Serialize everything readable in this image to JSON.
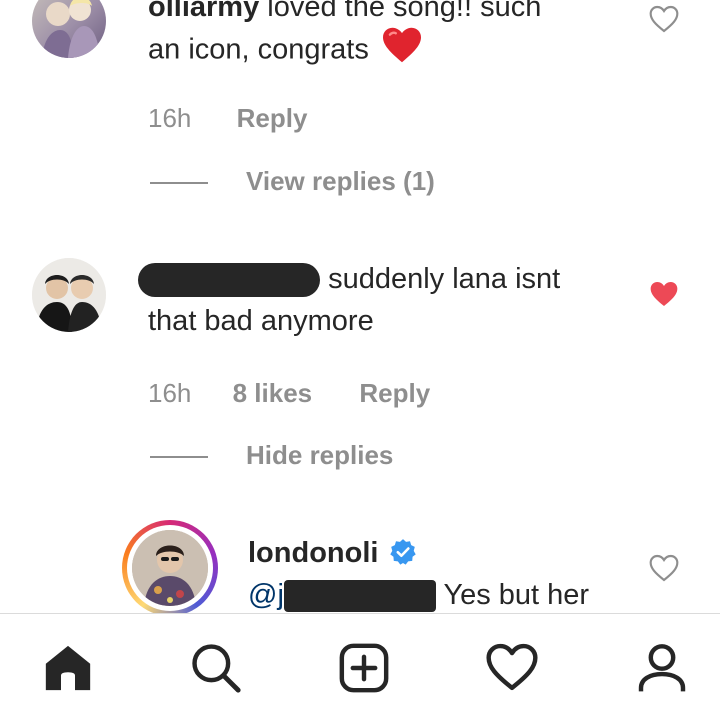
{
  "comments": [
    {
      "username": "olliarmy",
      "text_line1": "loved the song!! such",
      "text_line2": "an icon, congrats",
      "time": "16h",
      "reply_label": "Reply",
      "thread_toggle": "View replies (1)",
      "liked": false
    },
    {
      "text_line1": "suddenly lana isnt",
      "text_line2": "that bad anymore",
      "time": "16h",
      "likes": "8 likes",
      "reply_label": "Reply",
      "thread_toggle": "Hide replies",
      "liked": true
    }
  ],
  "reply": {
    "username": "londonoli",
    "mention_prefix": "@j",
    "text": "Yes but her",
    "verified": true
  },
  "colors": {
    "like_red": "#ed4956",
    "verified_blue": "#3897f0",
    "meta_gray": "#8e8e8e",
    "text": "#262626"
  },
  "navbar": {
    "items": [
      "home-icon",
      "search-icon",
      "new-post-icon",
      "activity-heart-icon",
      "profile-icon"
    ]
  }
}
